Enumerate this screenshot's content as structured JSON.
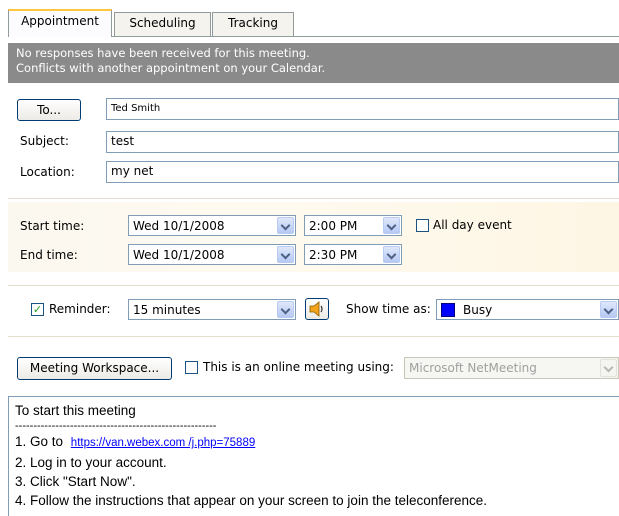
{
  "tabs": [
    {
      "label": "Appointment",
      "active": true
    },
    {
      "label": "Scheduling",
      "active": false
    },
    {
      "label": "Tracking",
      "active": false
    }
  ],
  "info": {
    "line1": "No responses have been received for this meeting.",
    "line2": "Conflicts with another appointment on your Calendar."
  },
  "header": {
    "to_button": "To...",
    "to_value": "Ted Smith",
    "subject_label": "Subject:",
    "subject_value": "test",
    "location_label": "Location:",
    "location_value": "my net"
  },
  "time": {
    "start_label": "Start time:",
    "start_date": "Wed 10/1/2008",
    "start_time": "2:00 PM",
    "all_day_label": "All day event",
    "all_day_checked": false,
    "end_label": "End time:",
    "end_date": "Wed 10/1/2008",
    "end_time": "2:30 PM"
  },
  "reminder": {
    "checked": true,
    "label": "Reminder:",
    "value": "15 minutes",
    "sound_icon": "speaker-icon",
    "show_time_label": "Show time as:",
    "show_time_value": "Busy",
    "busy_color": "#0000ff"
  },
  "meeting": {
    "workspace_button": "Meeting Workspace...",
    "online_label": "This is an online meeting using:",
    "online_checked": false,
    "online_value": "Microsoft NetMeeting"
  },
  "notes": {
    "line1": "To start this meeting",
    "dashes": "-------------------------------------------------------",
    "step1_prefix": "1. Go to",
    "step1_link": "https://van.webex.com /j.php=75889",
    "step2": "2. Log in to your account.",
    "step3": "3. Click \"Start Now\".",
    "step4": "4. Follow the instructions that appear on your screen to join the teleconference."
  }
}
